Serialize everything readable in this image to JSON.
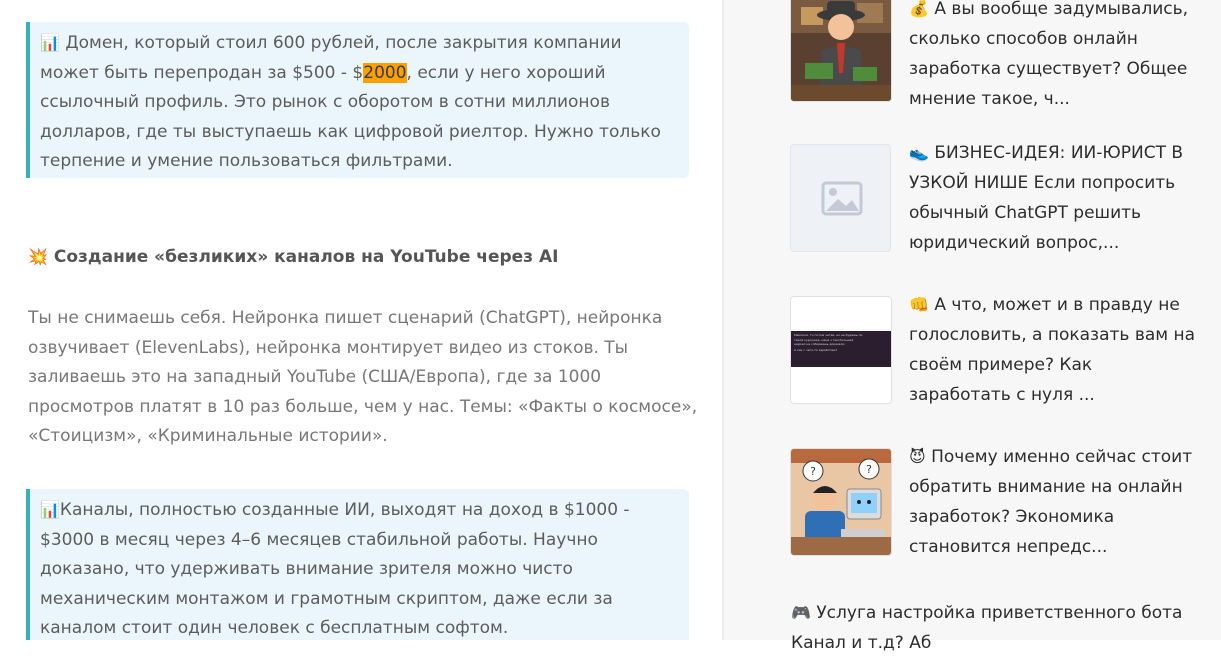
{
  "article": {
    "quote1": {
      "icon": "📊",
      "text_a": " Домен, который стоил 600 рублей, после закрытия компании может быть перепродан за $500 - $",
      "highlight": "2000",
      "text_b": ", если у него хороший ссылочный профиль. Это рынок с оборотом в сотни миллионов долларов, где ты выступаешь как цифровой риелтор. Нужно только терпение и умение пользоваться фильтрами."
    },
    "heading": {
      "icon": "💥",
      "text": " Создание «безликих» каналов на YouTube через AI"
    },
    "paragraph": "Ты не снимаешь себя. Нейронка пишет сценарий (ChatGPT), нейронка озвучивает (ElevenLabs), нейронка монтирует видео из стоков. Ты заливаешь это на западный YouTube (США/Европа), где за 1000 просмотров платят в 10 раз больше, чем у нас. Темы: «Факты о космосе», «Стоицизм», «Криминальные истории».",
    "quote2": {
      "icon": "📊",
      "text": "Каналы, полностью созданные ИИ, выходят на доход в $1000 - $3000 в месяц через 4–6 месяцев стабильной работы. Научно доказано, что удерживать внимание зрителя можно чисто механическим монтажом и грамотным скриптом, даже если за каналом стоит один человек с бесплатным софтом."
    }
  },
  "sidebar": {
    "items": [
      {
        "icon": "💰",
        "title": " А вы вообще задумывались, сколько способов онлайн заработка существует? Общее мнение такое, ч..."
      },
      {
        "icon": "👟",
        "title": " БИЗНЕС-ИДЕЯ: ИИ-ЮРИСТ В УЗКОЙ НИШЕ Если попросить обычный ChatGPT решить юридический вопрос,..."
      },
      {
        "icon": "👊",
        "title": " А что, может и в правду не голословить, а показать вам на своём примере? Как заработать с нуля ..."
      },
      {
        "icon": "😈",
        "title": " Почему именно сейчас стоит обратить внимание на онлайн заработок? Экономика становится непредс..."
      }
    ],
    "last": {
      "icon": "🎮",
      "title": " Услуга настройка приветственного бота",
      "title_line2": "                    Канал  и  т.д?  Аб"
    },
    "thumb3_lines": [
      "Мамочки, то потом читая, но не будешь по",
      "такой курсушке, меня з тем большая",
      "надоел не собираешь доказали",
      "А как с чего-то заработаю?"
    ]
  },
  "colors": {
    "quote_bg": "#eaf6fb",
    "quote_border": "#33b2b8",
    "highlight": "#ff9f00"
  }
}
